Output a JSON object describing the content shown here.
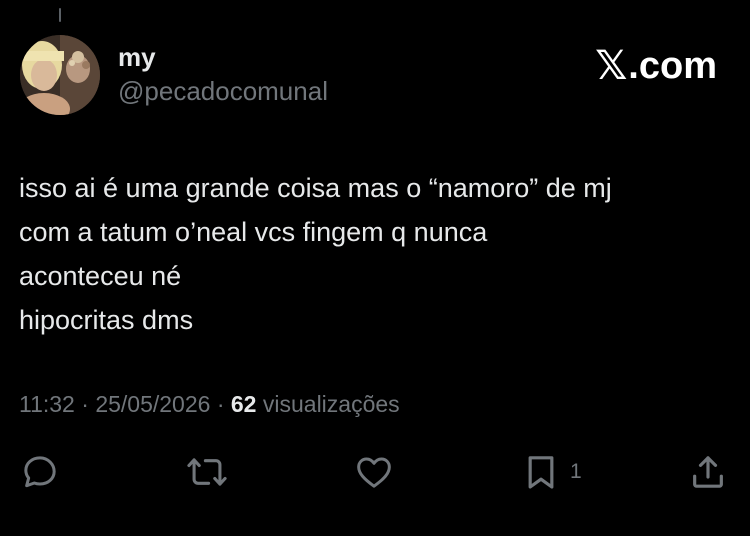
{
  "tweet": {
    "display_name": "my",
    "handle": "@pecadocomunal",
    "text_lines": [
      "isso ai é uma grande coisa mas o “namoro” de mj",
      "com a tatum o’neal vcs fingem q nunca",
      "aconteceu né",
      "hipocritas dms"
    ],
    "time": "11:32",
    "separator": "·",
    "date": "25/05/2026",
    "views_count": "62",
    "views_label": "visualizações"
  },
  "brand": {
    "x_glyph": "𝕏",
    "domain": ".com"
  },
  "actions": {
    "reply_icon": "speech-bubble-icon",
    "retweet_icon": "repost-icon",
    "like_icon": "heart-icon",
    "bookmark_icon": "bookmark-icon",
    "bookmark_count": "1",
    "share_icon": "share-upload-icon"
  },
  "colors": {
    "background": "#000000",
    "primary_text": "#e7e9ea",
    "secondary_text": "#71767b"
  }
}
